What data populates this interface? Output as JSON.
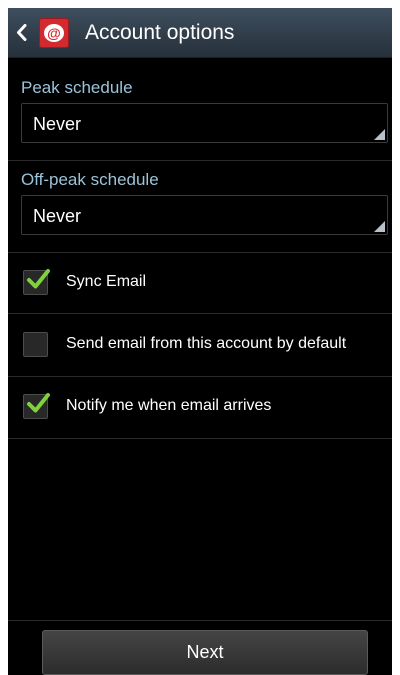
{
  "header": {
    "title": "Account options",
    "back_icon": "chevron-left-icon",
    "app_icon": "email-app-icon",
    "app_icon_glyph": "@"
  },
  "peak": {
    "label": "Peak schedule",
    "value": "Never"
  },
  "offpeak": {
    "label": "Off-peak schedule",
    "value": "Never"
  },
  "options": [
    {
      "label": "Sync Email",
      "checked": true
    },
    {
      "label": "Send email from this account by default",
      "checked": false
    },
    {
      "label": "Notify me when email arrives",
      "checked": true
    }
  ],
  "footer": {
    "next_label": "Next"
  },
  "colors": {
    "accent_label": "#9bc3da",
    "check": "#7fd23a",
    "app_icon": "#d22a2f"
  }
}
